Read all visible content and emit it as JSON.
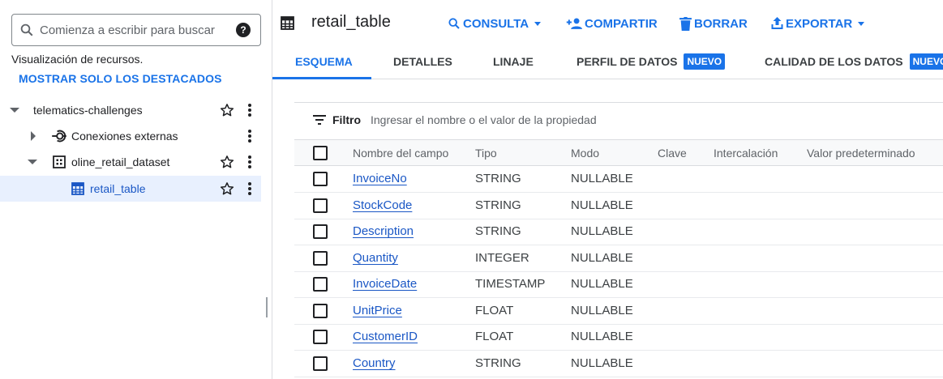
{
  "explorer": {
    "search_placeholder": "Comienza a escribir para buscar",
    "help_glyph": "?",
    "resources_text": "Visualización de recursos.",
    "show_starred_label": "MOSTRAR SOLO LOS DESTACADOS",
    "tree": [
      {
        "label": "telematics-challenges",
        "icon": "none",
        "expanded": true
      },
      {
        "label": "Conexiones externas",
        "icon": "external-connection-icon",
        "expanded": false
      },
      {
        "label": "oline_retail_dataset",
        "icon": "dataset-icon",
        "expanded": true
      },
      {
        "label": "retail_table",
        "icon": "table-icon",
        "selected": true
      }
    ]
  },
  "header": {
    "title": "retail_table",
    "actions": [
      {
        "label": "CONSULTA",
        "icon": "search-icon",
        "dropdown": true
      },
      {
        "label": "COMPARTIR",
        "icon": "person-add-icon",
        "dropdown": false
      },
      {
        "label": "BORRAR",
        "icon": "trash-icon",
        "dropdown": false
      },
      {
        "label": "EXPORTAR",
        "icon": "upload-icon",
        "dropdown": true
      }
    ]
  },
  "tabs": [
    {
      "label": "ESQUEMA",
      "active": true
    },
    {
      "label": "DETALLES"
    },
    {
      "label": "LINAJE"
    },
    {
      "label": "PERFIL DE DATOS",
      "badge": "NUEVO"
    },
    {
      "label": "CALIDAD DE LOS DATOS",
      "badge": "NUEVO"
    }
  ],
  "filter": {
    "label": "Filtro",
    "placeholder": "Ingresar el nombre o el valor de la propiedad"
  },
  "schema_table": {
    "columns": [
      "Nombre del campo",
      "Tipo",
      "Modo",
      "Clave",
      "Intercalación",
      "Valor predeterminado"
    ],
    "rows": [
      {
        "name": "InvoiceNo",
        "type": "STRING",
        "mode": "NULLABLE"
      },
      {
        "name": "StockCode",
        "type": "STRING",
        "mode": "NULLABLE"
      },
      {
        "name": "Description",
        "type": "STRING",
        "mode": "NULLABLE"
      },
      {
        "name": "Quantity",
        "type": "INTEGER",
        "mode": "NULLABLE"
      },
      {
        "name": "InvoiceDate",
        "type": "TIMESTAMP",
        "mode": "NULLABLE"
      },
      {
        "name": "UnitPrice",
        "type": "FLOAT",
        "mode": "NULLABLE"
      },
      {
        "name": "CustomerID",
        "type": "FLOAT",
        "mode": "NULLABLE"
      },
      {
        "name": "Country",
        "type": "STRING",
        "mode": "NULLABLE"
      }
    ]
  },
  "colors": {
    "accent": "#1a73e8",
    "selected_bg": "#e8f0fe",
    "badge_bg": "#1a73e8"
  }
}
